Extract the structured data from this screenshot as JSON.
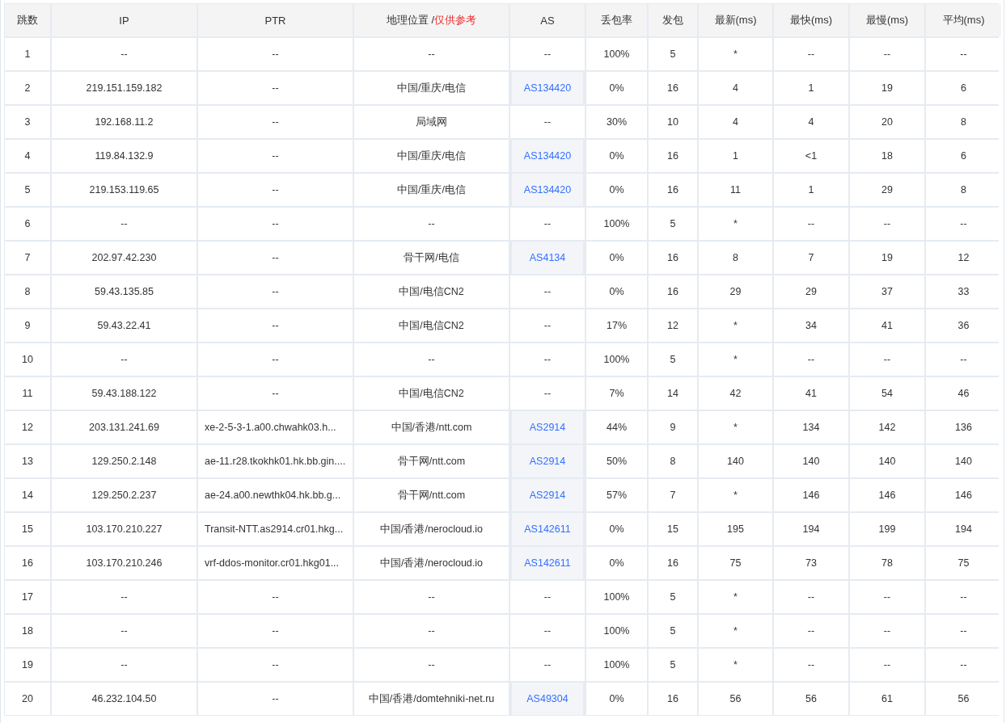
{
  "columns": [
    {
      "label": "跳数"
    },
    {
      "label": "IP"
    },
    {
      "label": "PTR"
    },
    {
      "label": "地理位置 / ",
      "note": "仅供参考"
    },
    {
      "label": "AS"
    },
    {
      "label": "丢包率"
    },
    {
      "label": "发包"
    },
    {
      "label": "最新(ms)"
    },
    {
      "label": "最快(ms)"
    },
    {
      "label": "最慢(ms)"
    },
    {
      "label": "平均(ms)"
    }
  ],
  "rows": [
    {
      "hop": "1",
      "ip": "--",
      "ptr": "--",
      "geo": "--",
      "as": "--",
      "as_link": false,
      "loss": "100%",
      "sent": "5",
      "last": "*",
      "best": "--",
      "worst": "--",
      "avg": "--"
    },
    {
      "hop": "2",
      "ip": "219.151.159.182",
      "ptr": "--",
      "geo": "中国/重庆/电信",
      "as": "AS134420",
      "as_link": true,
      "loss": "0%",
      "sent": "16",
      "last": "4",
      "best": "1",
      "worst": "19",
      "avg": "6"
    },
    {
      "hop": "3",
      "ip": "192.168.11.2",
      "ptr": "--",
      "geo": "局域网",
      "as": "--",
      "as_link": false,
      "loss": "30%",
      "sent": "10",
      "last": "4",
      "best": "4",
      "worst": "20",
      "avg": "8"
    },
    {
      "hop": "4",
      "ip": "119.84.132.9",
      "ptr": "--",
      "geo": "中国/重庆/电信",
      "as": "AS134420",
      "as_link": true,
      "loss": "0%",
      "sent": "16",
      "last": "1",
      "best": "<1",
      "worst": "18",
      "avg": "6"
    },
    {
      "hop": "5",
      "ip": "219.153.119.65",
      "ptr": "--",
      "geo": "中国/重庆/电信",
      "as": "AS134420",
      "as_link": true,
      "loss": "0%",
      "sent": "16",
      "last": "11",
      "best": "1",
      "worst": "29",
      "avg": "8"
    },
    {
      "hop": "6",
      "ip": "--",
      "ptr": "--",
      "geo": "--",
      "as": "--",
      "as_link": false,
      "loss": "100%",
      "sent": "5",
      "last": "*",
      "best": "--",
      "worst": "--",
      "avg": "--"
    },
    {
      "hop": "7",
      "ip": "202.97.42.230",
      "ptr": "--",
      "geo": "骨干网/电信",
      "as": "AS4134",
      "as_link": true,
      "loss": "0%",
      "sent": "16",
      "last": "8",
      "best": "7",
      "worst": "19",
      "avg": "12"
    },
    {
      "hop": "8",
      "ip": "59.43.135.85",
      "ptr": "--",
      "geo": "中国/电信CN2",
      "as": "--",
      "as_link": false,
      "loss": "0%",
      "sent": "16",
      "last": "29",
      "best": "29",
      "worst": "37",
      "avg": "33"
    },
    {
      "hop": "9",
      "ip": "59.43.22.41",
      "ptr": "--",
      "geo": "中国/电信CN2",
      "as": "--",
      "as_link": false,
      "loss": "17%",
      "sent": "12",
      "last": "*",
      "best": "34",
      "worst": "41",
      "avg": "36"
    },
    {
      "hop": "10",
      "ip": "--",
      "ptr": "--",
      "geo": "--",
      "as": "--",
      "as_link": false,
      "loss": "100%",
      "sent": "5",
      "last": "*",
      "best": "--",
      "worst": "--",
      "avg": "--"
    },
    {
      "hop": "11",
      "ip": "59.43.188.122",
      "ptr": "--",
      "geo": "中国/电信CN2",
      "as": "--",
      "as_link": false,
      "loss": "7%",
      "sent": "14",
      "last": "42",
      "best": "41",
      "worst": "54",
      "avg": "46"
    },
    {
      "hop": "12",
      "ip": "203.131.241.69",
      "ptr": "xe-2-5-3-1.a00.chwahk03.h...",
      "geo": "中国/香港/ntt.com",
      "as": "AS2914",
      "as_link": true,
      "loss": "44%",
      "sent": "9",
      "last": "*",
      "best": "134",
      "worst": "142",
      "avg": "136"
    },
    {
      "hop": "13",
      "ip": "129.250.2.148",
      "ptr": "ae-11.r28.tkokhk01.hk.bb.gin....",
      "geo": "骨干网/ntt.com",
      "as": "AS2914",
      "as_link": true,
      "loss": "50%",
      "sent": "8",
      "last": "140",
      "best": "140",
      "worst": "140",
      "avg": "140"
    },
    {
      "hop": "14",
      "ip": "129.250.2.237",
      "ptr": "ae-24.a00.newthk04.hk.bb.g...",
      "geo": "骨干网/ntt.com",
      "as": "AS2914",
      "as_link": true,
      "loss": "57%",
      "sent": "7",
      "last": "*",
      "best": "146",
      "worst": "146",
      "avg": "146"
    },
    {
      "hop": "15",
      "ip": "103.170.210.227",
      "ptr": "Transit-NTT.as2914.cr01.hkg...",
      "geo": "中国/香港/nerocloud.io",
      "as": "AS142611",
      "as_link": true,
      "loss": "0%",
      "sent": "15",
      "last": "195",
      "best": "194",
      "worst": "199",
      "avg": "194"
    },
    {
      "hop": "16",
      "ip": "103.170.210.246",
      "ptr": "vrf-ddos-monitor.cr01.hkg01...",
      "geo": "中国/香港/nerocloud.io",
      "as": "AS142611",
      "as_link": true,
      "loss": "0%",
      "sent": "16",
      "last": "75",
      "best": "73",
      "worst": "78",
      "avg": "75"
    },
    {
      "hop": "17",
      "ip": "--",
      "ptr": "--",
      "geo": "--",
      "as": "--",
      "as_link": false,
      "loss": "100%",
      "sent": "5",
      "last": "*",
      "best": "--",
      "worst": "--",
      "avg": "--"
    },
    {
      "hop": "18",
      "ip": "--",
      "ptr": "--",
      "geo": "--",
      "as": "--",
      "as_link": false,
      "loss": "100%",
      "sent": "5",
      "last": "*",
      "best": "--",
      "worst": "--",
      "avg": "--"
    },
    {
      "hop": "19",
      "ip": "--",
      "ptr": "--",
      "geo": "--",
      "as": "--",
      "as_link": false,
      "loss": "100%",
      "sent": "5",
      "last": "*",
      "best": "--",
      "worst": "--",
      "avg": "--"
    },
    {
      "hop": "20",
      "ip": "46.232.104.50",
      "ptr": "--",
      "geo": "中国/香港/domtehniki-net.ru",
      "as": "AS49304",
      "as_link": true,
      "loss": "0%",
      "sent": "16",
      "last": "56",
      "best": "56",
      "worst": "61",
      "avg": "56"
    }
  ]
}
